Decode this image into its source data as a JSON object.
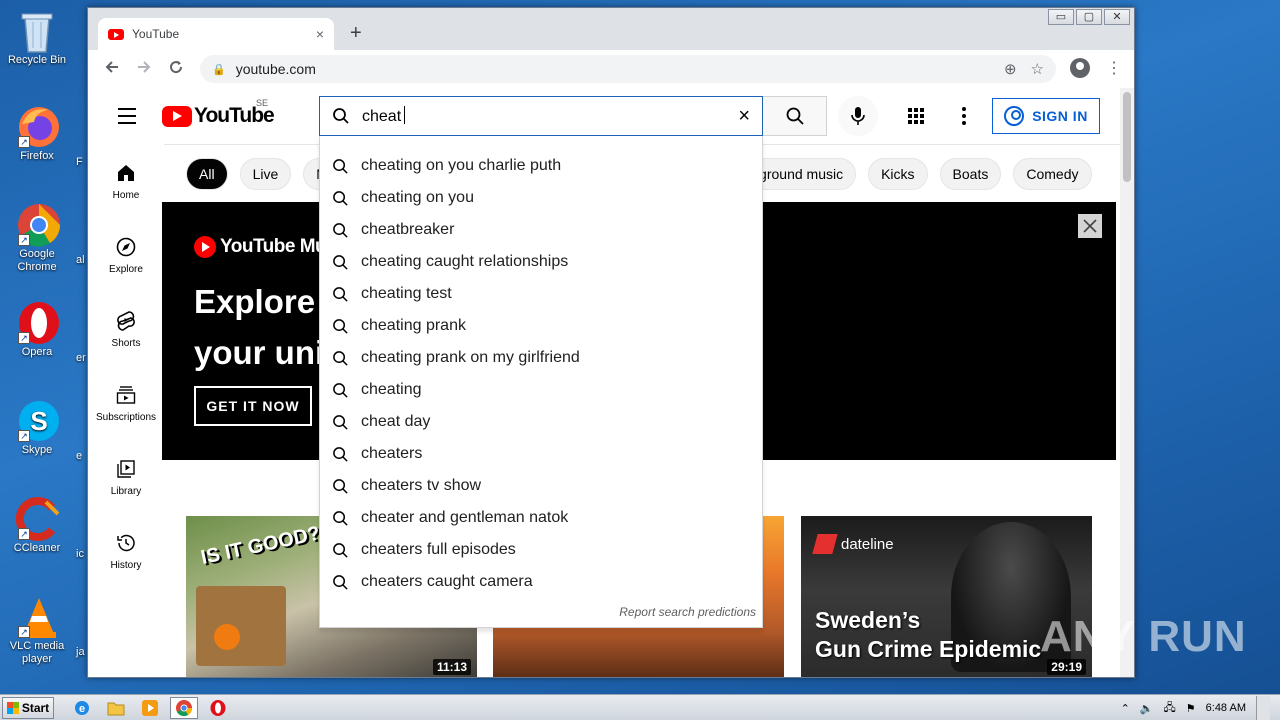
{
  "desktop": {
    "icons": [
      {
        "label": "Recycle Bin",
        "icon": "recycle-bin-icon"
      },
      {
        "label": "Firefox",
        "icon": "firefox-icon"
      },
      {
        "label": "Google Chrome",
        "icon": "chrome-icon"
      },
      {
        "label": "Opera",
        "icon": "opera-icon"
      },
      {
        "label": "Skype",
        "icon": "skype-icon"
      },
      {
        "label": "CCleaner",
        "icon": "ccleaner-icon"
      },
      {
        "label": "VLC media player",
        "icon": "vlc-icon"
      }
    ],
    "partial_labels": [
      "F",
      "al",
      "er",
      "e",
      "ic",
      "ja"
    ]
  },
  "browser": {
    "tab": {
      "title": "YouTube",
      "close": "×"
    },
    "new_tab": "+",
    "address": {
      "url": "youtube.com"
    },
    "window_controls": [
      "▭",
      "▢",
      "✕"
    ]
  },
  "youtube": {
    "logo_text": "YouTube",
    "country_code": "SE",
    "search": {
      "value": "cheat",
      "clear": "×"
    },
    "signin_label": "SIGN IN",
    "guide": [
      {
        "label": "Home",
        "icon": "home-icon"
      },
      {
        "label": "Explore",
        "icon": "compass-icon"
      },
      {
        "label": "Shorts",
        "icon": "shorts-icon"
      },
      {
        "label": "Subscriptions",
        "icon": "subscriptions-icon"
      },
      {
        "label": "Library",
        "icon": "library-icon"
      },
      {
        "label": "History",
        "icon": "history-icon"
      }
    ],
    "chips": [
      "All",
      "Live",
      "M",
      "Background music",
      "Kicks",
      "Boats",
      "Comedy"
    ],
    "banner": {
      "brand": "YouTube Music",
      "headline_line1": "Explore",
      "headline_line2": "your uni",
      "cta": "GET IT NOW"
    },
    "suggestions": [
      "cheating on you charlie puth",
      "cheating on you",
      "cheatbreaker",
      "cheating caught relationships",
      "cheating test",
      "cheating prank",
      "cheating prank on my girlfriend",
      "cheating",
      "cheat day",
      "cheaters",
      "cheaters tv show",
      "cheater and gentleman natok",
      "cheaters full episodes",
      "cheaters caught camera"
    ],
    "report_label": "Report search predictions",
    "videos": [
      {
        "overlay": "IS IT GOOD?!",
        "duration": "11:13"
      },
      {
        "overlay": "",
        "duration": ""
      },
      {
        "brand": "dateline",
        "title_line1": "Sweden’s",
        "title_line2": "Gun Crime Epidemic",
        "duration": "29:19"
      }
    ]
  },
  "watermark": "ANY RUN",
  "taskbar": {
    "start_label": "Start",
    "clock": "6:48 AM"
  }
}
